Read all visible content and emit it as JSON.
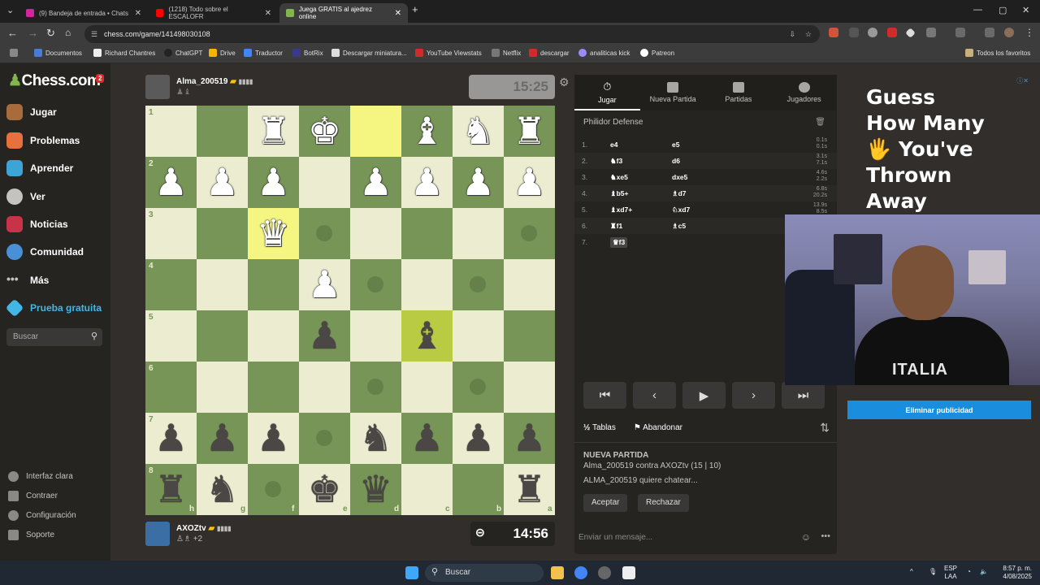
{
  "browser": {
    "tabs": [
      {
        "title": "(9) Bandeja de entrada • Chats",
        "color": "#d6249f"
      },
      {
        "title": "(1218) Todo sobre el ESCALOFR",
        "color": "#ff0000"
      },
      {
        "title": "Juega GRATIS al ajedrez online",
        "color": "#81b64c"
      }
    ],
    "url": "chess.com/game/141498030108",
    "bookmarks": [
      "Documentos",
      "Richard Chantres",
      "ChatGPT",
      "Drive",
      "Traductor",
      "BotRix",
      "Descargar miniatura...",
      "YouTube Viewstats",
      "Netflix",
      "descargar",
      "analiticas kick",
      "Patreon"
    ],
    "all_favorites": "Todos los favoritos"
  },
  "sidebar": {
    "logo": "Chess.com",
    "badge": "2",
    "items": [
      {
        "label": "Jugar",
        "color": "#a86c3c"
      },
      {
        "label": "Problemas",
        "color": "#e8703c"
      },
      {
        "label": "Aprender",
        "color": "#3da4d6"
      },
      {
        "label": "Ver",
        "color": "#c5c3c0"
      },
      {
        "label": "Noticias",
        "color": "#c8334a"
      },
      {
        "label": "Comunidad",
        "color": "#4a90d6"
      },
      {
        "label": "Más",
        "color": "#c5c3c0"
      },
      {
        "label": "Prueba gratuita",
        "color": "#42b6e5"
      }
    ],
    "search_placeholder": "Buscar",
    "footer": [
      "Interfaz clara",
      "Contraer",
      "Configuración",
      "Soporte"
    ]
  },
  "top_player": {
    "name": "Alma_200519",
    "clock": "15:25"
  },
  "bottom_player": {
    "name": "AXOZtv",
    "captured_extra": "+2",
    "clock": "14:56"
  },
  "board": {
    "ranks": [
      "1",
      "2",
      "3",
      "4",
      "5",
      "6",
      "7",
      "8"
    ],
    "files": [
      "h",
      "g",
      "f",
      "e",
      "d",
      "c",
      "b",
      "a"
    ],
    "pieces": [
      {
        "r": 0,
        "c": 2,
        "p": "♜",
        "side": "w"
      },
      {
        "r": 0,
        "c": 3,
        "p": "♚",
        "side": "w"
      },
      {
        "r": 0,
        "c": 5,
        "p": "♝",
        "side": "w"
      },
      {
        "r": 0,
        "c": 6,
        "p": "♞",
        "side": "w"
      },
      {
        "r": 0,
        "c": 7,
        "p": "♜",
        "side": "w"
      },
      {
        "r": 1,
        "c": 0,
        "p": "♟",
        "side": "w"
      },
      {
        "r": 1,
        "c": 1,
        "p": "♟",
        "side": "w"
      },
      {
        "r": 1,
        "c": 2,
        "p": "♟",
        "side": "w"
      },
      {
        "r": 1,
        "c": 4,
        "p": "♟",
        "side": "w"
      },
      {
        "r": 1,
        "c": 5,
        "p": "♟",
        "side": "w"
      },
      {
        "r": 1,
        "c": 6,
        "p": "♟",
        "side": "w"
      },
      {
        "r": 1,
        "c": 7,
        "p": "♟",
        "side": "w"
      },
      {
        "r": 2,
        "c": 2,
        "p": "♛",
        "side": "w"
      },
      {
        "r": 3,
        "c": 3,
        "p": "♟",
        "side": "w"
      },
      {
        "r": 4,
        "c": 3,
        "p": "♟",
        "side": "b"
      },
      {
        "r": 4,
        "c": 5,
        "p": "♝",
        "side": "b"
      },
      {
        "r": 6,
        "c": 0,
        "p": "♟",
        "side": "b"
      },
      {
        "r": 6,
        "c": 1,
        "p": "♟",
        "side": "b"
      },
      {
        "r": 6,
        "c": 2,
        "p": "♟",
        "side": "b"
      },
      {
        "r": 6,
        "c": 4,
        "p": "♞",
        "side": "b"
      },
      {
        "r": 6,
        "c": 5,
        "p": "♟",
        "side": "b"
      },
      {
        "r": 6,
        "c": 6,
        "p": "♟",
        "side": "b"
      },
      {
        "r": 6,
        "c": 7,
        "p": "♟",
        "side": "b"
      },
      {
        "r": 7,
        "c": 0,
        "p": "♜",
        "side": "b"
      },
      {
        "r": 7,
        "c": 1,
        "p": "♞",
        "side": "b"
      },
      {
        "r": 7,
        "c": 3,
        "p": "♚",
        "side": "b"
      },
      {
        "r": 7,
        "c": 4,
        "p": "♛",
        "side": "b"
      },
      {
        "r": 7,
        "c": 7,
        "p": "♜",
        "side": "b"
      }
    ],
    "highlight_squares": [
      [
        0,
        4
      ],
      [
        2,
        2
      ]
    ],
    "selected_square": [
      4,
      5
    ],
    "move_hints": [
      [
        2,
        3
      ],
      [
        2,
        7
      ],
      [
        3,
        4
      ],
      [
        3,
        6
      ],
      [
        5,
        4
      ],
      [
        5,
        6
      ],
      [
        6,
        3
      ],
      [
        7,
        2
      ]
    ]
  },
  "panel": {
    "tabs": [
      "Jugar",
      "Nueva Partida",
      "Partidas",
      "Jugadores"
    ],
    "opening": "Philidor Defense",
    "moves": [
      {
        "n": "1.",
        "w": "e4",
        "b": "e5",
        "t1": "0.1s",
        "t2": "0.1s"
      },
      {
        "n": "2.",
        "w": "♞f3",
        "b": "d6",
        "t1": "3.1s",
        "t2": "7.1s"
      },
      {
        "n": "3.",
        "w": "♞xe5",
        "b": "dxe5",
        "t1": "4.6s",
        "t2": "2.2s"
      },
      {
        "n": "4.",
        "w": "♝b5+",
        "b": "♗d7",
        "t1": "6.8s",
        "t2": "20.2s"
      },
      {
        "n": "5.",
        "w": "♝xd7+",
        "b": "♘xd7",
        "t1": "13.9s",
        "t2": "8.5s"
      },
      {
        "n": "6.",
        "w": "♜f1",
        "b": "♗c5",
        "t1": "",
        "t2": ""
      },
      {
        "n": "7.",
        "w": "♛f3",
        "b": "",
        "t1": "",
        "t2": ""
      }
    ],
    "draw_label": "Tablas",
    "resign_label": "Abandonar",
    "chat_title": "NUEVA PARTIDA",
    "chat_line1": "Alma_200519 contra AXOZtv (15 | 10)",
    "chat_line2": "ALMA_200519 quiere chatear...",
    "accept": "Aceptar",
    "reject": "Rechazar",
    "message_placeholder": "Enviar un mensaje..."
  },
  "ad": {
    "text": [
      "Guess",
      "How Many",
      "🖐 You've",
      "Thrown",
      "Away"
    ],
    "remove_ads": "Eliminar publicidad",
    "shirt_text": "ITALIA"
  },
  "taskbar": {
    "search": "Buscar",
    "lang": "ESP",
    "lang2": "LAA",
    "time": "8:57 p. m.",
    "date": "4/08/2025"
  }
}
